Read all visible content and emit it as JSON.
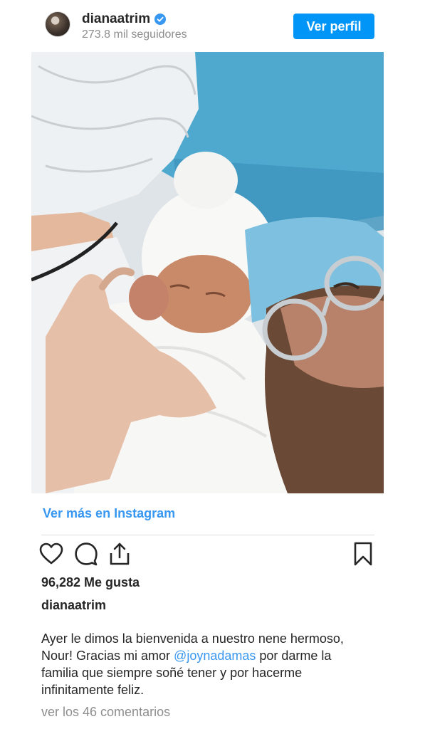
{
  "header": {
    "username": "dianaatrim",
    "followers": "273.8 mil seguidores",
    "view_profile_label": "Ver perfil",
    "verified_icon": "verified-badge-icon",
    "accent_color": "#0095f6"
  },
  "post": {
    "image_icon": "photo-newborn",
    "more_link": "Ver más en Instagram",
    "actions": {
      "like_icon": "heart-icon",
      "comment_icon": "comment-icon",
      "share_icon": "share-icon",
      "save_icon": "bookmark-icon"
    },
    "likes": "96,282 Me gusta",
    "owner": "dianaatrim",
    "caption_line1": "Ayer le dimos la bienvenida a nuestro nene hermoso,",
    "caption_line2_pre": "Nour! Gracias mi amor ",
    "caption_mention": "@joynadamas",
    "caption_line2_post": " por darme la",
    "caption_line3": "familia que siempre soñé tener y por hacerme",
    "caption_line4": "infinitamente feliz.",
    "comments_link": "ver los 46 comentarios",
    "link_color": "#3897f0"
  }
}
